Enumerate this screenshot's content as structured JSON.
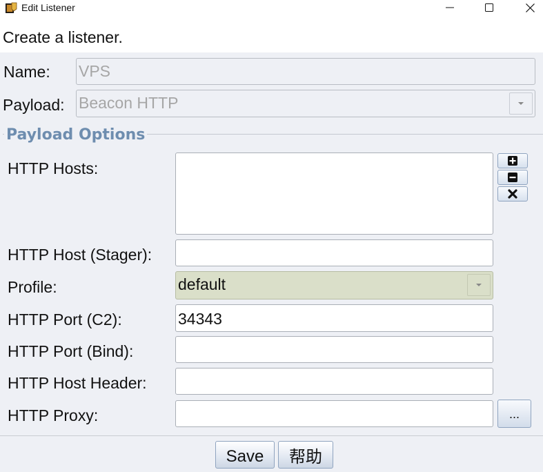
{
  "window": {
    "title": "Edit Listener",
    "icons": {
      "app": "listener-app-icon",
      "minimize": "minimize-icon",
      "maximize": "maximize-icon",
      "close": "close-icon"
    }
  },
  "header": {
    "text": "Create a listener."
  },
  "name": {
    "label": "Name:",
    "value": "VPS"
  },
  "payload": {
    "label": "Payload:",
    "value": "Beacon HTTP",
    "arrow_icon": "chevron-down-icon"
  },
  "payload_options": {
    "title": "Payload Options",
    "http_hosts": {
      "label": "HTTP Hosts:",
      "values": [],
      "buttons": {
        "add_icon": "plus-icon",
        "remove_icon": "minus-icon",
        "clear_icon": "x-icon"
      }
    },
    "http_host_stager": {
      "label": "HTTP Host (Stager):",
      "value": ""
    },
    "profile": {
      "label": "Profile:",
      "value": "default",
      "arrow_icon": "chevron-down-icon"
    },
    "http_port_c2": {
      "label": "HTTP Port (C2):",
      "value": "34343"
    },
    "http_port_bind": {
      "label": "HTTP Port (Bind):",
      "value": ""
    },
    "http_host_header": {
      "label": "HTTP Host Header:",
      "value": ""
    },
    "http_proxy": {
      "label": "HTTP Proxy:",
      "value": "",
      "browse_label": "..."
    }
  },
  "footer": {
    "save_label": "Save",
    "help_label": "帮助"
  },
  "colors": {
    "background": "#eef0f5",
    "section_title": "#6e8daf",
    "profile_bg": "#dadfc9",
    "button_border": "#8ea3bf"
  }
}
